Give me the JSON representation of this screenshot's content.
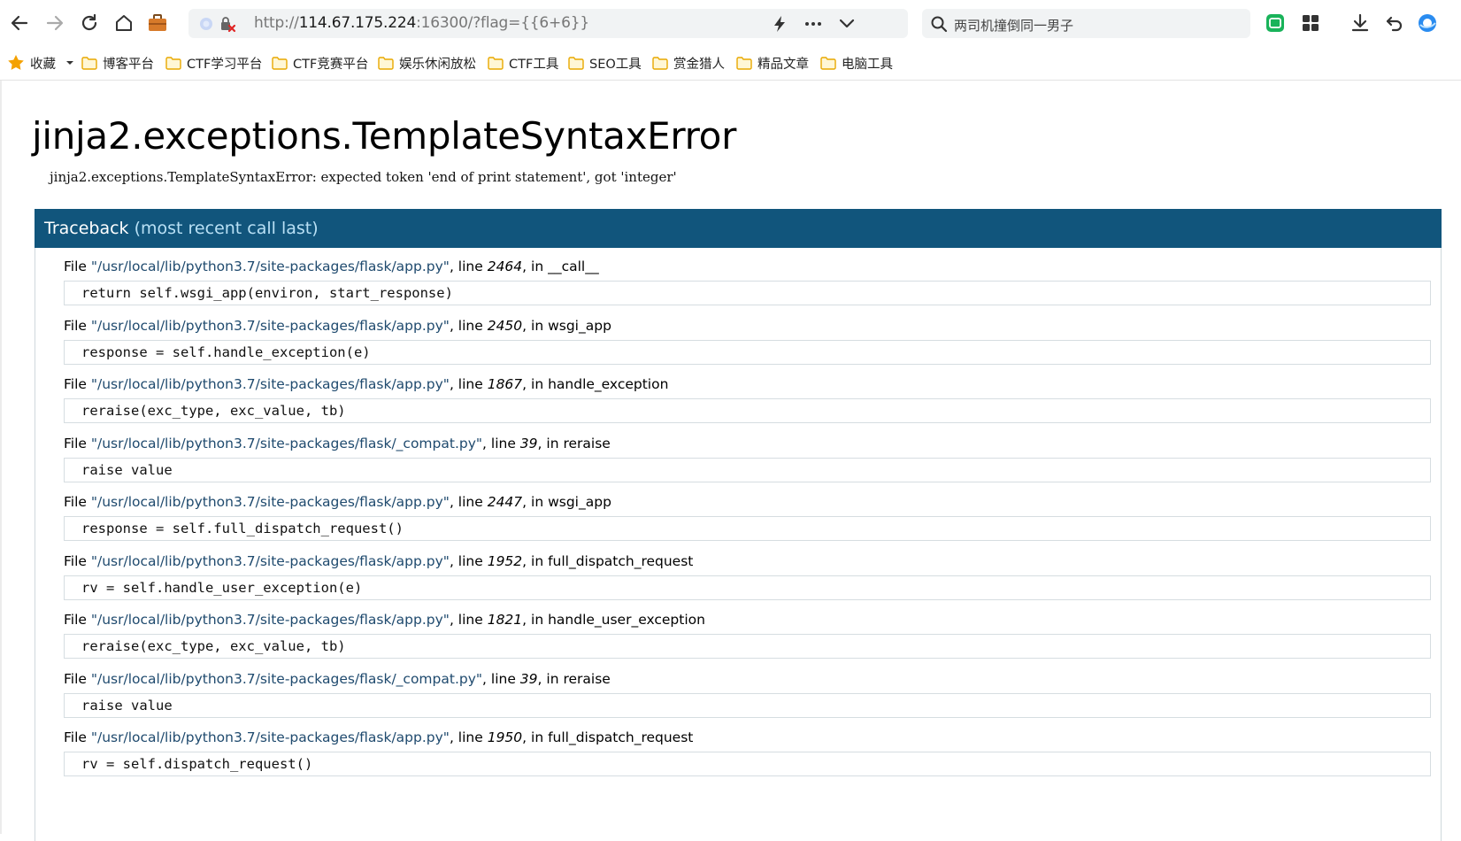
{
  "browser": {
    "url_prefix": "http://",
    "url_host": "114.67.175.224",
    "url_rest": ":16300/?flag={{6+6}}",
    "search_query": "两司机撞倒同一男子",
    "accent": "#11557c"
  },
  "bookmarks": {
    "favorites_label": "收藏",
    "items": [
      "博客平台",
      "CTF学习平台",
      "CTF竞赛平台",
      "娱乐休闲放松",
      "CTF工具",
      "SEO工具",
      "赏金猎人",
      "精品文章",
      "电脑工具"
    ]
  },
  "error": {
    "title": "jinja2.exceptions.TemplateSyntaxError",
    "message": "jinja2.exceptions.TemplateSyntaxError: expected token 'end of print statement', got 'integer'"
  },
  "traceback": {
    "title": "Traceback",
    "subtitle": "(most recent call last)",
    "file_word": "File ",
    "line_word": ", line ",
    "in_word": ", in ",
    "frames": [
      {
        "file": "\"/usr/local/lib/python3.7/site-packages/flask/app.py\"",
        "line": "2464",
        "func": "__call__",
        "code": "return self.wsgi_app(environ, start_response)"
      },
      {
        "file": "\"/usr/local/lib/python3.7/site-packages/flask/app.py\"",
        "line": "2450",
        "func": "wsgi_app",
        "code": "response = self.handle_exception(e)"
      },
      {
        "file": "\"/usr/local/lib/python3.7/site-packages/flask/app.py\"",
        "line": "1867",
        "func": "handle_exception",
        "code": "reraise(exc_type, exc_value, tb)"
      },
      {
        "file": "\"/usr/local/lib/python3.7/site-packages/flask/_compat.py\"",
        "line": "39",
        "func": "reraise",
        "code": "raise value"
      },
      {
        "file": "\"/usr/local/lib/python3.7/site-packages/flask/app.py\"",
        "line": "2447",
        "func": "wsgi_app",
        "code": "response = self.full_dispatch_request()"
      },
      {
        "file": "\"/usr/local/lib/python3.7/site-packages/flask/app.py\"",
        "line": "1952",
        "func": "full_dispatch_request",
        "code": "rv = self.handle_user_exception(e)"
      },
      {
        "file": "\"/usr/local/lib/python3.7/site-packages/flask/app.py\"",
        "line": "1821",
        "func": "handle_user_exception",
        "code": "reraise(exc_type, exc_value, tb)"
      },
      {
        "file": "\"/usr/local/lib/python3.7/site-packages/flask/_compat.py\"",
        "line": "39",
        "func": "reraise",
        "code": "raise value"
      },
      {
        "file": "\"/usr/local/lib/python3.7/site-packages/flask/app.py\"",
        "line": "1950",
        "func": "full_dispatch_request",
        "code": "rv = self.dispatch_request()"
      }
    ]
  }
}
